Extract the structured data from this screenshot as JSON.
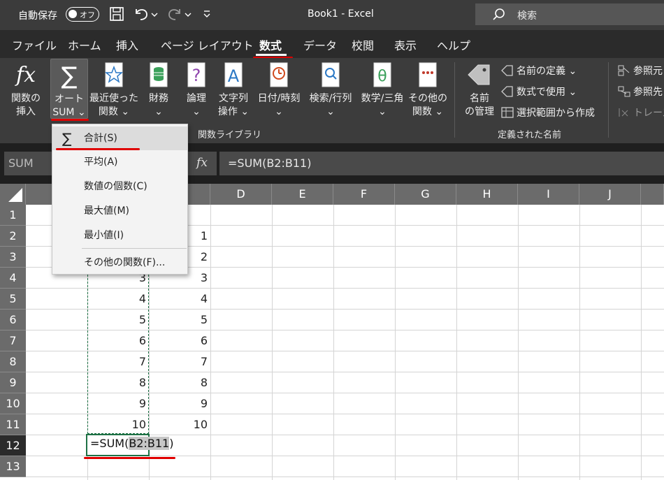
{
  "titlebar": {
    "autosave_label": "自動保存",
    "autosave_state": "オフ",
    "document_title": "Book1 - Excel",
    "search_placeholder": "検索"
  },
  "tabs": [
    {
      "label": "ファイル"
    },
    {
      "label": "ホーム"
    },
    {
      "label": "挿入"
    },
    {
      "label": "ページ レイアウト"
    },
    {
      "label": "数式",
      "active": true
    },
    {
      "label": "データ"
    },
    {
      "label": "校閲"
    },
    {
      "label": "表示"
    },
    {
      "label": "ヘルプ"
    }
  ],
  "ribbon": {
    "function_library": {
      "group_label": "関数ライブラリ",
      "insert_function": {
        "line1": "関数の",
        "line2": "挿入"
      },
      "autosum": {
        "line1": "オート",
        "line2": "SUM ⌄"
      },
      "recent": {
        "line1": "最近使った",
        "line2": "関数 ⌄"
      },
      "financial": {
        "line1": "財務",
        "line2": "⌄"
      },
      "logical": {
        "line1": "論理",
        "line2": "⌄"
      },
      "text": {
        "line1": "文字列",
        "line2": "操作 ⌄"
      },
      "datetime": {
        "line1": "日付/時刻",
        "line2": "⌄"
      },
      "lookup": {
        "line1": "検索/行列",
        "line2": "⌄"
      },
      "math": {
        "line1": "数学/三角",
        "line2": "⌄"
      },
      "more": {
        "line1": "その他の",
        "line2": "関数 ⌄"
      }
    },
    "defined_names": {
      "group_label": "定義された名前",
      "name_manager": {
        "line1": "名前",
        "line2": "の管理"
      },
      "define_name": "名前の定義 ⌄",
      "use_in_formula": "数式で使用 ⌄",
      "create_from_selection": "選択範囲から作成"
    },
    "auditing": {
      "trace_precedents": "参照元",
      "trace_dependents": "参照先",
      "remove_arrows": "トレース"
    }
  },
  "formula_bar": {
    "name_box": "SUM",
    "fx_label": "fx",
    "formula": "=SUM(B2:B11)"
  },
  "columns": [
    "D",
    "E",
    "F",
    "G",
    "H",
    "I",
    "J"
  ],
  "rows": [
    "1",
    "2",
    "3",
    "4",
    "5",
    "6",
    "7",
    "8",
    "9",
    "10",
    "11",
    "12",
    "13"
  ],
  "column_b_values": [
    "3",
    "4",
    "5",
    "6",
    "7",
    "8",
    "9",
    "10"
  ],
  "column_c_values": [
    "1",
    "2",
    "3",
    "4",
    "5",
    "6",
    "7",
    "8",
    "9",
    "10"
  ],
  "active_cell": {
    "prefix": "=SUM(",
    "ref": "B2:B11",
    "suffix": ")"
  },
  "autosum_menu": [
    {
      "label": "合計(S)",
      "icon": "sigma-icon",
      "highlighted": true
    },
    {
      "label": "平均(A)"
    },
    {
      "label": "数値の個数(C)"
    },
    {
      "label": "最大値(M)"
    },
    {
      "label": "最小値(I)"
    },
    {
      "label": "その他の関数(F)..."
    }
  ],
  "colors": {
    "annotation_red": "#e00000",
    "selection_green": "#1e7145"
  }
}
